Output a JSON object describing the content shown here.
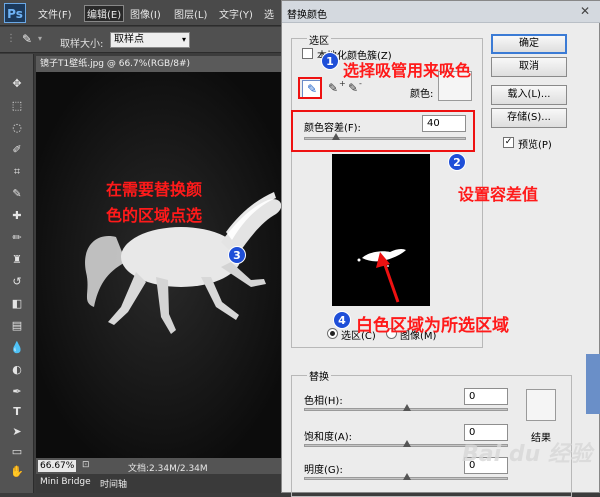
{
  "app": {
    "logo": "Ps",
    "menus": [
      "文件(F)",
      "编辑(E)",
      "图像(I)",
      "图层(L)",
      "文字(Y)",
      "选"
    ],
    "active_menu_index": 1
  },
  "options_bar": {
    "sample_size_label": "取样大小:",
    "sample_size_value": "取样点"
  },
  "document": {
    "tab_title": "镜子T1壁纸.jpg @ 66.7%(RGB/8#)",
    "zoom": "66.67%",
    "doc_info": "文档:2.34M/2.34M",
    "bottom_tabs": [
      "Mini Bridge",
      "时间轴"
    ]
  },
  "dialog": {
    "title": "替换颜色",
    "selection_group": "选区",
    "localized_clusters_label": "本地化颜色簇(Z)",
    "color_label": "颜色:",
    "fuzziness_label": "颜色容差(F):",
    "fuzziness_value": "40",
    "fuzziness": 40,
    "radio_selection": "选区(C)",
    "radio_image": "图像(M)",
    "buttons": {
      "ok": "确定",
      "cancel": "取消",
      "load": "载入(L)...",
      "save": "存储(S)..."
    },
    "preview_label": "预览(P)",
    "preview_checked": true,
    "replace_group": "替换",
    "hue_label": "色相(H):",
    "hue_value": "0",
    "saturation_label": "饱和度(A):",
    "saturation_value": "0",
    "lightness_label": "明度(G):",
    "lightness_value": "0",
    "result_label": "结果"
  },
  "annotations": {
    "step1_num": "1",
    "step1_text": "选择吸管用来吸色",
    "step2_num": "2",
    "step2_text": "设置容差值",
    "step3_num": "3",
    "step3_text_line1": "在需要替换颜",
    "step3_text_line2": "色的区域点选",
    "step4_num": "4",
    "step4_text": "白色区域为所选区域"
  },
  "watermark": "Bai du 经验",
  "colors": {
    "annotation_red": "#ff1a1a",
    "badge_blue": "#1f4fd8",
    "dialog_bg": "#ececec",
    "app_dark": "#3c3c3c"
  }
}
